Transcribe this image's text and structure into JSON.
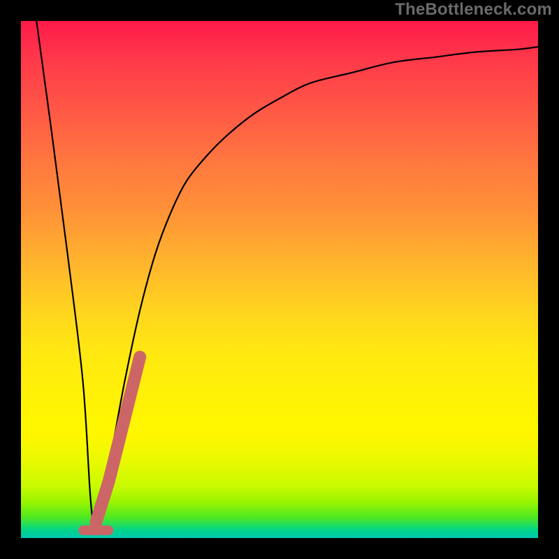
{
  "attribution": "TheBottleneck.com",
  "chart_data": {
    "type": "line",
    "title": "",
    "xlabel": "",
    "ylabel": "",
    "xlim": [
      0,
      100
    ],
    "ylim": [
      0,
      100
    ],
    "series": [
      {
        "name": "main-curve",
        "x": [
          3,
          6,
          9,
          12,
          13.5,
          14.5,
          17,
          20,
          23,
          26,
          29,
          32,
          36,
          40,
          45,
          50,
          56,
          64,
          72,
          80,
          88,
          96,
          100
        ],
        "y": [
          100,
          78,
          55,
          30,
          7,
          3,
          14,
          30,
          44,
          55,
          63,
          69,
          74,
          78,
          82,
          85,
          88,
          90,
          92,
          93,
          94,
          94.5,
          95
        ],
        "style": "thin-black"
      },
      {
        "name": "marker-segment",
        "x": [
          14.5,
          17,
          19,
          21,
          23
        ],
        "y": [
          3,
          11,
          19,
          27,
          35
        ],
        "style": "thick-coral"
      },
      {
        "name": "marker-dot",
        "x": [
          14.5
        ],
        "y": [
          1.5
        ],
        "style": "coral-dot"
      }
    ],
    "colors": {
      "curve": "#000000",
      "marker": "#cc6666",
      "gradient_top": "#ff1a4a",
      "gradient_mid": "#ffd41f",
      "gradient_band": "#fff700",
      "gradient_bottom": "#00d48a"
    }
  }
}
